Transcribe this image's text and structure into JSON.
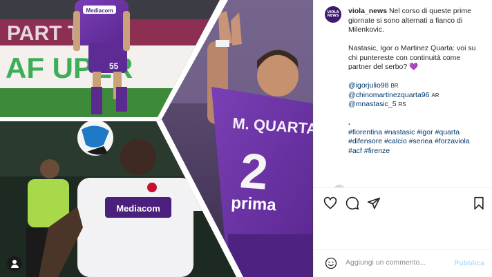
{
  "post": {
    "username": "viola_news",
    "avatar_text": "VIOLA NEWS",
    "caption_line1": "Nel corso di queste prime giornate si sono alternati a fianco di Milenkovic.",
    "caption_line2": "Nastasic, Igor o Martinez Quarta: voi su chi puntereste con continuità come partner del serbo?",
    "heart": "💜",
    "mentions": [
      {
        "handle": "@igorjulio98",
        "flag": "BR"
      },
      {
        "handle": "@chinomartinezquarta96",
        "flag": "AR"
      },
      {
        "handle": "@mnastasic_5",
        "flag": "RS"
      }
    ],
    "dot": ".",
    "hashtags": [
      "#fiorentina",
      "#nastasic",
      "#igor",
      "#quarta",
      "#difensore",
      "#calcio",
      "#seriea",
      "#forzaviola",
      "#acf",
      "#firenze"
    ]
  },
  "media": {
    "top_left": {
      "banner_text": "PART  TO",
      "ad_text": "AF  UPER",
      "jersey_sponsor": "Mediacom",
      "number": "55"
    },
    "right": {
      "name": "M. QUARTA",
      "number": "2",
      "sponsor": "prima"
    },
    "bottom_left": {
      "sponsor": "Mediacom"
    }
  },
  "actions": {
    "like": "heart-icon",
    "comment": "comment-icon",
    "share": "share-icon",
    "save": "bookmark-icon"
  },
  "composer": {
    "placeholder": "Aggiungi un commento...",
    "publish_label": "Pubblica"
  }
}
